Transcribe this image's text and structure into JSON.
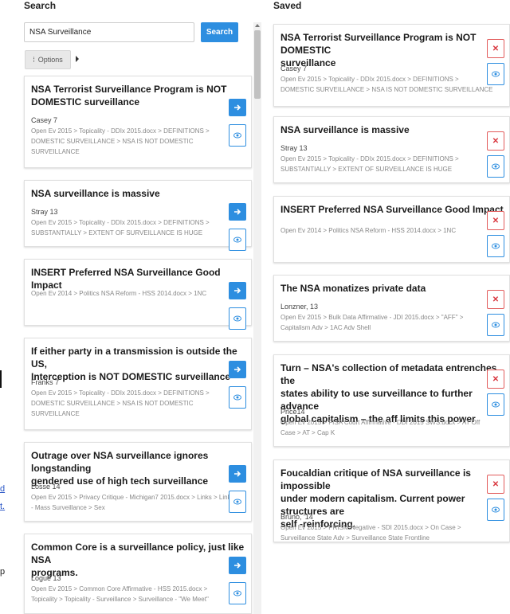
{
  "left_fragments": {
    "d": "d",
    "t": "t.",
    "p": "p"
  },
  "search": {
    "header": "Search",
    "query": "NSA Surveillance",
    "button_label": "Search",
    "options_label": "Options",
    "results": [
      {
        "title_lines": [
          "NSA Terrorist Surveillance Program is NOT",
          "DOMESTIC surveillance"
        ],
        "author": "Casey 7",
        "path_lines": [
          "Open Ev 2015 > Topicality - DDIx 2015.docx > DEFINITIONS >",
          "DOMESTIC SURVEILLANCE > NSA IS NOT DOMESTIC",
          "SURVEILLANCE"
        ]
      },
      {
        "title_lines": [
          "NSA surveillance is massive"
        ],
        "author": "Stray 13",
        "path_lines": [
          "Open Ev 2015 > Topicality - DDIx 2015.docx > DEFINITIONS >",
          "SUBSTANTIALLY > EXTENT OF SURVEILLANCE IS HUGE"
        ]
      },
      {
        "title_lines": [
          "INSERT Preferred NSA Surveillance Good Impact"
        ],
        "author": "",
        "path_lines": [
          "Open Ev 2014 > Politics NSA Reform - HSS 2014.docx > 1NC"
        ]
      },
      {
        "title_lines": [
          "If either party in a transmission is outside the US,",
          "Interception is NOT DOMESTIC surveillance"
        ],
        "author": "Franks 7",
        "path_lines": [
          "Open Ev 2015 > Topicality - DDIx 2015.docx > DEFINITIONS >",
          "DOMESTIC SURVEILLANCE > NSA IS NOT DOMESTIC",
          "SURVEILLANCE"
        ]
      },
      {
        "title_lines": [
          "Outrage over NSA surveillance ignores longstanding",
          "gendered use of high tech surveillance"
        ],
        "author": "Losse 14",
        "path_lines": [
          "Open Ev 2015 > Privacy Critique - Michigan7 2015.docx > Links > Link",
          "- Mass Surveillance > Sex"
        ]
      },
      {
        "title_lines": [
          "Common Core is a surveillance policy, just like NSA",
          "programs."
        ],
        "author": "Logue 13",
        "path_lines": [
          "Open Ev 2015 > Common Core Affirmative - HSS 2015.docx >",
          "Topicality > Topicality - Surveillance > Surveillance - \"We Meet\""
        ]
      }
    ]
  },
  "saved": {
    "header": "Saved",
    "items": [
      {
        "title_lines": [
          "NSA Terrorist Surveillance Program is NOT DOMESTIC",
          "surveillance"
        ],
        "author": "Casey 7",
        "path_lines": [
          "Open Ev 2015 > Topicality - DDIx 2015.docx > DEFINITIONS >",
          "DOMESTIC SURVEILLANCE > NSA IS NOT DOMESTIC SURVEILLANCE"
        ]
      },
      {
        "title_lines": [
          "NSA surveillance is massive"
        ],
        "author": "Stray 13",
        "path_lines": [
          "Open Ev 2015 > Topicality - DDIx 2015.docx > DEFINITIONS >",
          "SUBSTANTIALLY > EXTENT OF SURVEILLANCE IS HUGE"
        ]
      },
      {
        "title_lines": [
          "INSERT Preferred NSA Surveillance Good Impact"
        ],
        "author": "",
        "path_lines": [
          "Open Ev 2014 > Politics NSA Reform - HSS 2014.docx > 1NC"
        ]
      },
      {
        "title_lines": [
          "The NSA monatizes private data"
        ],
        "author": "Lonzner, 13",
        "path_lines": [
          "Open Ev 2015 > Bulk Data Affirmative - JDI 2015.docx > \"AFF\" >",
          "Capitalism Adv > 1AC Adv Shell"
        ]
      },
      {
        "title_lines": [
          "Turn – NSA's collection of metadata entrenches the",
          "states ability to use surveillance to further advance",
          "global capitalism – the aff limits this power"
        ],
        "author": "Price14",
        "path_lines": [
          "Open Ev 2015 > FISA Court Affirmative - DDI 2015 SWS.docx > AT Off",
          "Case > AT > Cap K"
        ]
      },
      {
        "title_lines": [
          "Foucaldian critique of NSA surveillance is impossible",
          "under modern capitalism. Current power structures are",
          "self -reinforcing."
        ],
        "author": "Bruno, '14",
        "path_lines": [
          "Open Ev 2015 > PRISM Negative - SDI 2015.docx > On Case >",
          "Surveillance State Adv > Surveillance State Frontline"
        ]
      }
    ]
  }
}
